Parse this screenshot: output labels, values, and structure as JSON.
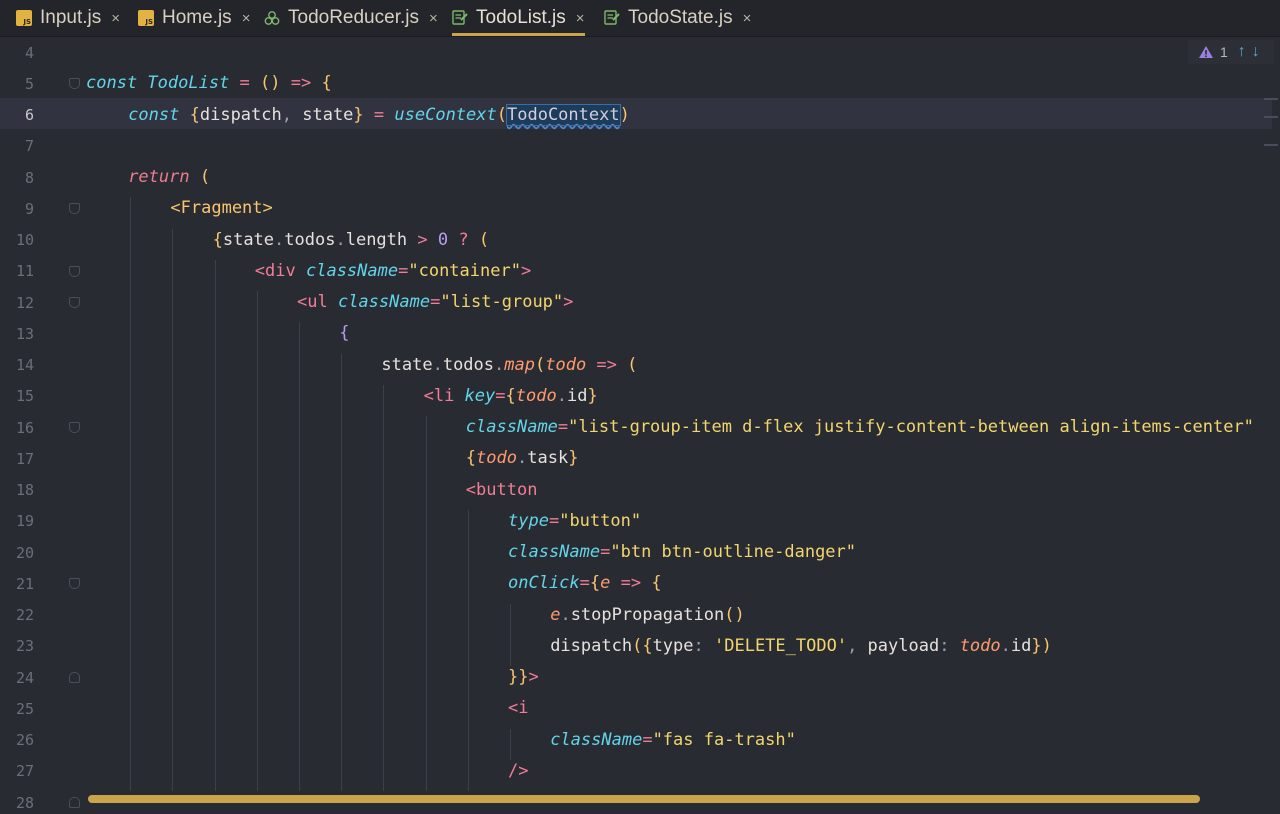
{
  "tabs": [
    {
      "label": "Input.js",
      "icon": "js-file-icon",
      "active": false
    },
    {
      "label": "Home.js",
      "icon": "js-file-icon",
      "active": false
    },
    {
      "label": "TodoReducer.js",
      "icon": "redux-icon",
      "active": false
    },
    {
      "label": "TodoList.js",
      "icon": "component-file-icon",
      "active": true
    },
    {
      "label": "TodoState.js",
      "icon": "component-file-icon",
      "active": false
    }
  ],
  "close_glyph": "×",
  "inspection": {
    "warnings": "1",
    "up_glyph": "↑",
    "down_glyph": "↓"
  },
  "current_line": 6,
  "line_numbers": [
    "4",
    "5",
    "6",
    "7",
    "8",
    "9",
    "10",
    "11",
    "12",
    "13",
    "14",
    "15",
    "16",
    "17",
    "18",
    "19",
    "20",
    "21",
    "22",
    "23",
    "24",
    "25",
    "26",
    "27",
    "28"
  ],
  "colors": {
    "background": "#292b33",
    "current_line": "#313440",
    "accent_tab_underline": "#c9a44a",
    "scrollbar": "#c9a44a",
    "keyword": "#ec7c8c",
    "attribute": "#62d4e8",
    "string": "#f2d56c"
  },
  "code": [
    {
      "n": "4",
      "parts": []
    },
    {
      "n": "5",
      "parts": [
        [
          "kw2",
          "const "
        ],
        [
          "kw2",
          "TodoList"
        ],
        [
          "op",
          " = "
        ],
        [
          "brace",
          "() "
        ],
        [
          "op",
          "=> "
        ],
        [
          "brace",
          "{"
        ]
      ]
    },
    {
      "n": "6",
      "parts": [
        [
          "kw2",
          "const "
        ],
        [
          "brace",
          "{"
        ],
        [
          "plain",
          "dispatch"
        ],
        [
          "punct",
          ", "
        ],
        [
          "plain",
          "state"
        ],
        [
          "brace",
          "}"
        ],
        [
          "op",
          " = "
        ],
        [
          "kw2",
          "useContext"
        ],
        [
          "brace",
          "("
        ],
        [
          "sel",
          "TodoContext"
        ],
        [
          "brace",
          ")"
        ]
      ]
    },
    {
      "n": "7",
      "parts": []
    },
    {
      "n": "8",
      "parts": [
        [
          "kw",
          "return "
        ],
        [
          "brace",
          "("
        ]
      ]
    },
    {
      "n": "9",
      "parts": [
        [
          "brace",
          "<"
        ],
        [
          "brace",
          "Fragment"
        ],
        [
          "brace",
          ">"
        ]
      ]
    },
    {
      "n": "10",
      "parts": [
        [
          "brace",
          "{"
        ],
        [
          "plain",
          "state"
        ],
        [
          "punct",
          "."
        ],
        [
          "plain",
          "todos"
        ],
        [
          "punct",
          "."
        ],
        [
          "plain",
          "length "
        ],
        [
          "op",
          "> "
        ],
        [
          "num",
          "0 "
        ],
        [
          "op",
          "? "
        ],
        [
          "brace",
          "("
        ]
      ]
    },
    {
      "n": "11",
      "parts": [
        [
          "tag",
          "<div "
        ],
        [
          "attr",
          "className"
        ],
        [
          "op",
          "="
        ],
        [
          "str",
          "\"container\""
        ],
        [
          "tag",
          ">"
        ]
      ]
    },
    {
      "n": "12",
      "parts": [
        [
          "tag",
          "<ul "
        ],
        [
          "attr",
          "className"
        ],
        [
          "op",
          "="
        ],
        [
          "str",
          "\"list-group\""
        ],
        [
          "tag",
          ">"
        ]
      ]
    },
    {
      "n": "13",
      "parts": [
        [
          "brace2",
          "{"
        ]
      ]
    },
    {
      "n": "14",
      "parts": [
        [
          "plain",
          "state"
        ],
        [
          "punct",
          "."
        ],
        [
          "plain",
          "todos"
        ],
        [
          "punct",
          "."
        ],
        [
          "fn",
          "map"
        ],
        [
          "brace",
          "("
        ],
        [
          "param",
          "todo "
        ],
        [
          "op",
          "=> "
        ],
        [
          "brace",
          "("
        ]
      ]
    },
    {
      "n": "15",
      "parts": [
        [
          "tag",
          "<li "
        ],
        [
          "attr",
          "key"
        ],
        [
          "op",
          "="
        ],
        [
          "brace",
          "{"
        ],
        [
          "param",
          "todo"
        ],
        [
          "punct",
          "."
        ],
        [
          "plain",
          "id"
        ],
        [
          "brace",
          "}"
        ]
      ]
    },
    {
      "n": "16",
      "parts": [
        [
          "attr",
          "className"
        ],
        [
          "op",
          "="
        ],
        [
          "str",
          "\"list-group-item d-flex justify-content-between align-items-center\""
        ]
      ]
    },
    {
      "n": "17",
      "parts": [
        [
          "brace",
          "{"
        ],
        [
          "param",
          "todo"
        ],
        [
          "punct",
          "."
        ],
        [
          "plain",
          "task"
        ],
        [
          "brace",
          "}"
        ]
      ]
    },
    {
      "n": "18",
      "parts": [
        [
          "tag",
          "<button"
        ]
      ]
    },
    {
      "n": "19",
      "parts": [
        [
          "attr",
          "type"
        ],
        [
          "op",
          "="
        ],
        [
          "str",
          "\"button\""
        ]
      ]
    },
    {
      "n": "20",
      "parts": [
        [
          "attr",
          "className"
        ],
        [
          "op",
          "="
        ],
        [
          "str",
          "\"btn btn-outline-danger\""
        ]
      ]
    },
    {
      "n": "21",
      "parts": [
        [
          "attr",
          "onClick"
        ],
        [
          "op",
          "="
        ],
        [
          "brace",
          "{"
        ],
        [
          "param",
          "e "
        ],
        [
          "op",
          "=> "
        ],
        [
          "brace",
          "{"
        ]
      ]
    },
    {
      "n": "22",
      "parts": [
        [
          "param",
          "e"
        ],
        [
          "punct",
          "."
        ],
        [
          "plain",
          "stopPropagation"
        ],
        [
          "brace",
          "()"
        ]
      ]
    },
    {
      "n": "23",
      "parts": [
        [
          "plain",
          "dispatch"
        ],
        [
          "brace",
          "({"
        ],
        [
          "plain",
          "type"
        ],
        [
          "punct",
          ": "
        ],
        [
          "str2",
          "'DELETE_TODO'"
        ],
        [
          "punct",
          ", "
        ],
        [
          "plain",
          "payload"
        ],
        [
          "punct",
          ": "
        ],
        [
          "param",
          "todo"
        ],
        [
          "punct",
          "."
        ],
        [
          "plain",
          "id"
        ],
        [
          "brace",
          "})"
        ]
      ]
    },
    {
      "n": "24",
      "parts": [
        [
          "brace",
          "}}"
        ],
        [
          "tag",
          ">"
        ]
      ]
    },
    {
      "n": "25",
      "parts": [
        [
          "tag",
          "<i"
        ]
      ]
    },
    {
      "n": "26",
      "parts": [
        [
          "attr",
          "className"
        ],
        [
          "op",
          "="
        ],
        [
          "str",
          "\"fas fa-trash\""
        ]
      ]
    },
    {
      "n": "27",
      "parts": [
        [
          "tag",
          "/>"
        ]
      ]
    },
    {
      "n": "28",
      "parts": []
    }
  ]
}
